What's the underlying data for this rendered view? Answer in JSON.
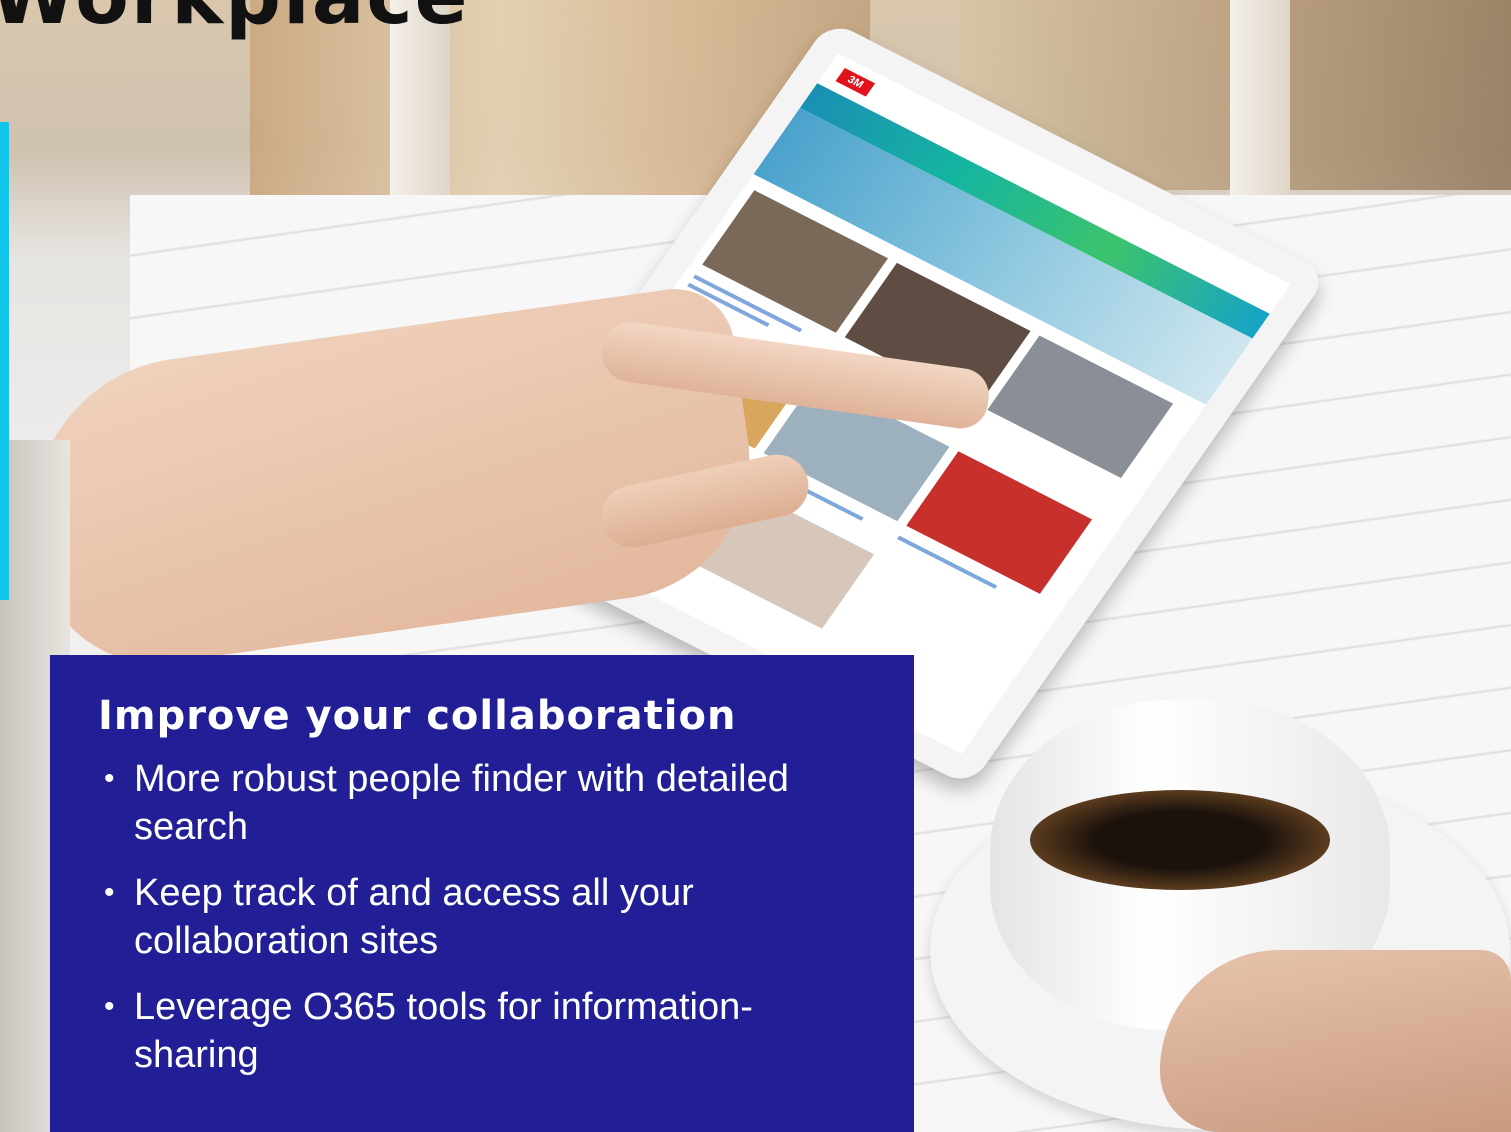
{
  "slide": {
    "title": "Workplace",
    "panel": {
      "heading": "Improve your collaboration",
      "bullets": [
        "More robust people finder with detailed search",
        "Keep track of and access all your collaboration sites",
        "Leverage O365 tools for  information-sharing"
      ]
    },
    "tablet_logo": "3M"
  },
  "colors": {
    "panel_background": "#221f96",
    "accent_bar": "#11c6ea",
    "panel_text": "#ffffff",
    "title_text": "#111111"
  }
}
